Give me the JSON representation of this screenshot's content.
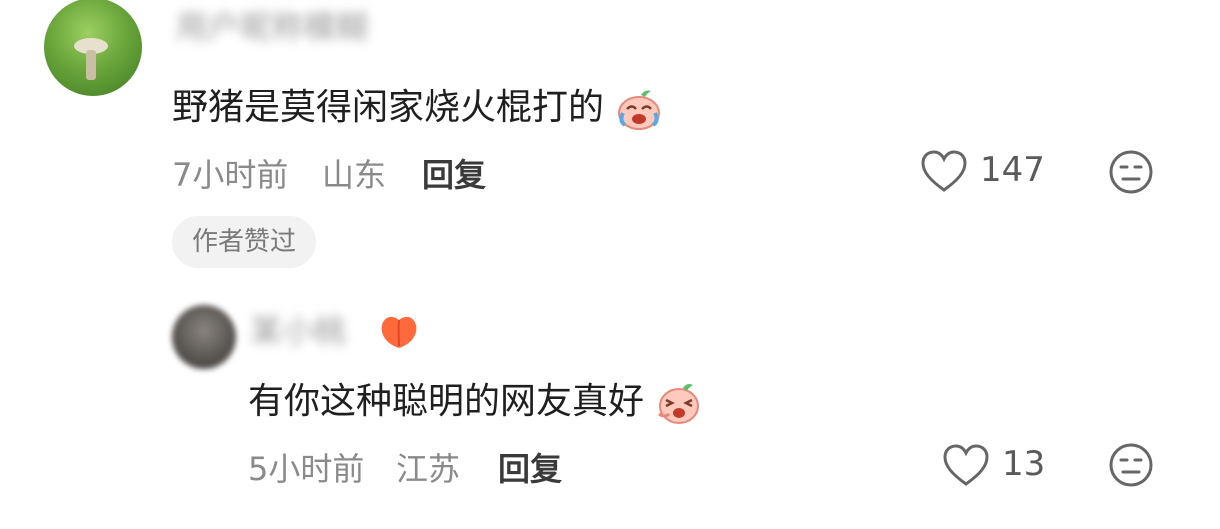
{
  "comments": [
    {
      "nickname": "用户昵称模糊",
      "text": "野猪是莫得闲家烧火棍打的",
      "time": "7小时前",
      "location": "山东",
      "reply_label": "回复",
      "likes": "147",
      "badge": "作者赞过"
    },
    {
      "nickname": "某小桃",
      "text": "有你这种聪明的网友真好",
      "time": "5小时前",
      "location": "江苏",
      "reply_label": "回复",
      "likes": "13"
    }
  ],
  "icons": {
    "heart": "heart-outline-icon",
    "dislike": "neutral-face-icon",
    "emoji_crying": "crying-laugh-emoji-icon",
    "emoji_laughing": "laughing-emoji-icon",
    "peach_badge": "peach-icon"
  },
  "colors": {
    "text": "#1f1f1f",
    "meta": "#8a8a8a",
    "badge_bg": "#f2f2f2",
    "peach": "#ff6a3d"
  }
}
